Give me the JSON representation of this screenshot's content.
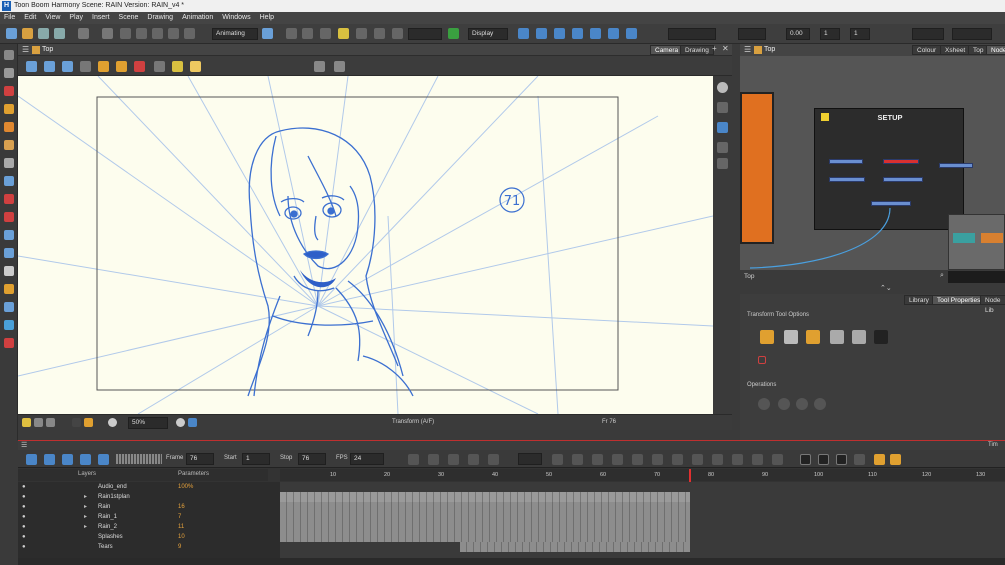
{
  "window": {
    "title": "Toon Boom Harmony Scene: RAIN Version: RAIN_v4 *"
  },
  "menu": [
    "File",
    "Edit",
    "View",
    "Play",
    "Insert",
    "Scene",
    "Drawing",
    "Animation",
    "Windows",
    "Help"
  ],
  "toolbar": {
    "mode": "Animating",
    "display": "Display",
    "angle": "0.00",
    "field1": "1",
    "field2": "1"
  },
  "view": {
    "title": "Top",
    "tabs": [
      "Camera",
      "Drawing"
    ],
    "zoom": "50%",
    "status": "Transform (A/F)",
    "frame_label": "Fr 76",
    "sketch_annotation": "71"
  },
  "node_view": {
    "title": "Top",
    "tabs": [
      "Colour",
      "Xsheet",
      "Top",
      "Node"
    ],
    "group_label": "SETUP",
    "search_label": "Top"
  },
  "properties": {
    "tabs": [
      "Library",
      "Tool Properties",
      "Node Lib"
    ],
    "section1": "Transform Tool Options",
    "section2": "Operations"
  },
  "timeline": {
    "frame_label": "Frame",
    "frame_value": "76",
    "start_label": "Start",
    "start_value": "1",
    "stop_label": "Stop",
    "stop_value": "76",
    "fps_label": "FPS",
    "fps_value": "24",
    "layers_header": "Layers",
    "params_header": "Parameters",
    "right_tab": "Tim",
    "ruler": [
      "10",
      "20",
      "30",
      "40",
      "50",
      "60",
      "70",
      "80",
      "90",
      "100",
      "110",
      "120",
      "130"
    ],
    "layers": [
      {
        "name": "Audio_end",
        "param": "100%"
      },
      {
        "name": "Rain1stplan",
        "param": ""
      },
      {
        "name": "Rain",
        "param": "16"
      },
      {
        "name": "Rain_1",
        "param": "7"
      },
      {
        "name": "Rain_2",
        "param": "11"
      },
      {
        "name": "Splashes",
        "param": "10"
      },
      {
        "name": "Tears",
        "param": "9"
      }
    ]
  }
}
